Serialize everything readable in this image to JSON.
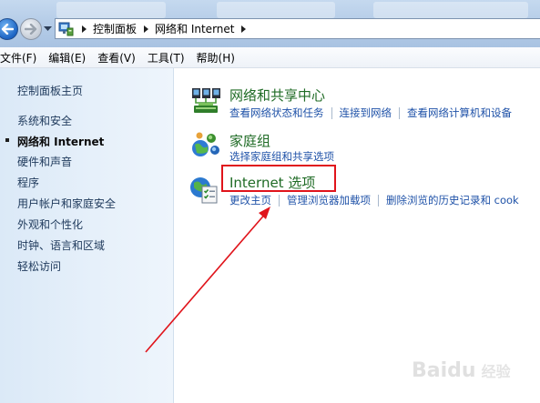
{
  "address_bar": {
    "crumbs": [
      "控制面板",
      "网络和 Internet"
    ]
  },
  "menu": {
    "items": [
      "文件(F)",
      "编辑(E)",
      "查看(V)",
      "工具(T)",
      "帮助(H)"
    ]
  },
  "sidebar": {
    "home": "控制面板主页",
    "items": [
      {
        "label": "系统和安全",
        "current": false
      },
      {
        "label": "网络和 Internet",
        "current": true
      },
      {
        "label": "硬件和声音",
        "current": false
      },
      {
        "label": "程序",
        "current": false
      },
      {
        "label": "用户帐户和家庭安全",
        "current": false
      },
      {
        "label": "外观和个性化",
        "current": false
      },
      {
        "label": "时钟、语言和区域",
        "current": false
      },
      {
        "label": "轻松访问",
        "current": false
      }
    ]
  },
  "categories": [
    {
      "icon": "network-sharing-center-icon",
      "title": "网络和共享中心",
      "links": [
        "查看网络状态和任务",
        "连接到网络",
        "查看网络计算机和设备"
      ]
    },
    {
      "icon": "homegroup-icon",
      "title": "家庭组",
      "links": [
        "选择家庭组和共享选项"
      ]
    },
    {
      "icon": "internet-options-icon",
      "title": "Internet 选项",
      "links": [
        "更改主页",
        "管理浏览器加载项",
        "删除浏览的历史记录和 cook"
      ]
    }
  ],
  "annotation": {
    "highlight_color": "#e0141b",
    "target": "Internet 选项"
  },
  "watermark": {
    "logo": "Baidu",
    "sub": "经验"
  },
  "colors": {
    "link": "#1f52a8",
    "category_title": "#1f6b25",
    "sidebar_text": "#1e395b"
  }
}
